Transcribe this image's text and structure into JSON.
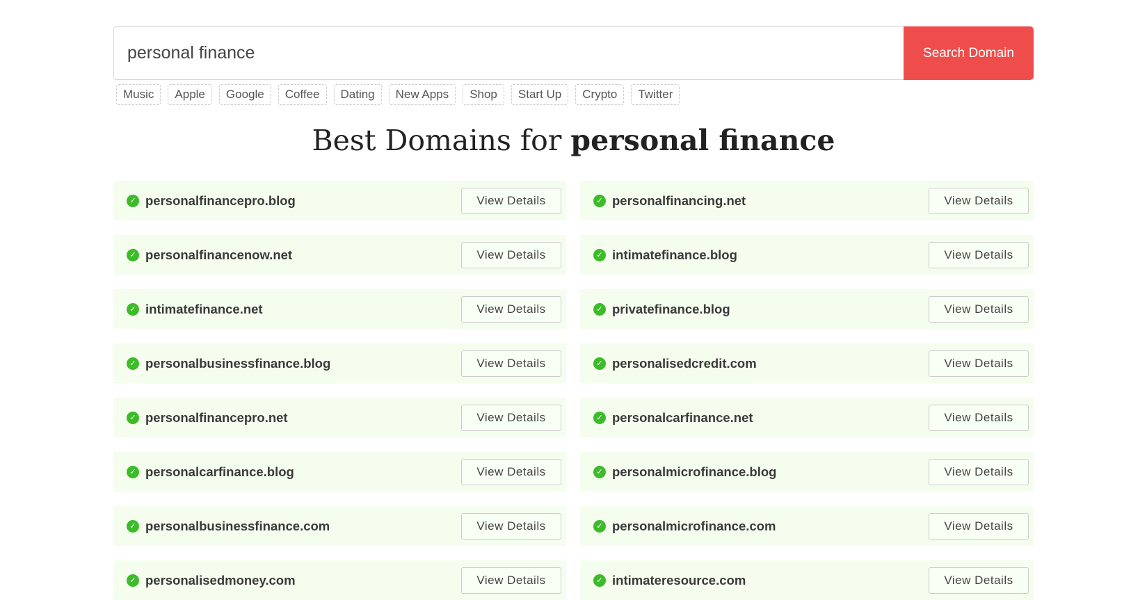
{
  "search": {
    "value": "personal finance",
    "button_label": "Search Domain",
    "button_color": "#ef4d4b"
  },
  "tags": [
    "Music",
    "Apple",
    "Google",
    "Coffee",
    "Dating",
    "New Apps",
    "Shop",
    "Start Up",
    "Crypto",
    "Twitter"
  ],
  "heading": {
    "prefix": "Best Domains for ",
    "query": "personal finance"
  },
  "view_details_label": "View Details",
  "domains": [
    "personalfinancepro.blog",
    "personalfinancing.net",
    "personalfinancenow.net",
    "intimatefinance.blog",
    "intimatefinance.net",
    "privatefinance.blog",
    "personalbusinessfinance.blog",
    "personalisedcredit.com",
    "personalfinancepro.net",
    "personalcarfinance.net",
    "personalcarfinance.blog",
    "personalmicrofinance.blog",
    "personalbusinessfinance.com",
    "personalmicrofinance.com",
    "personalisedmoney.com",
    "intimateresource.com"
  ],
  "status_icon": "check-circle-icon",
  "available_color": "#3dbb2a"
}
